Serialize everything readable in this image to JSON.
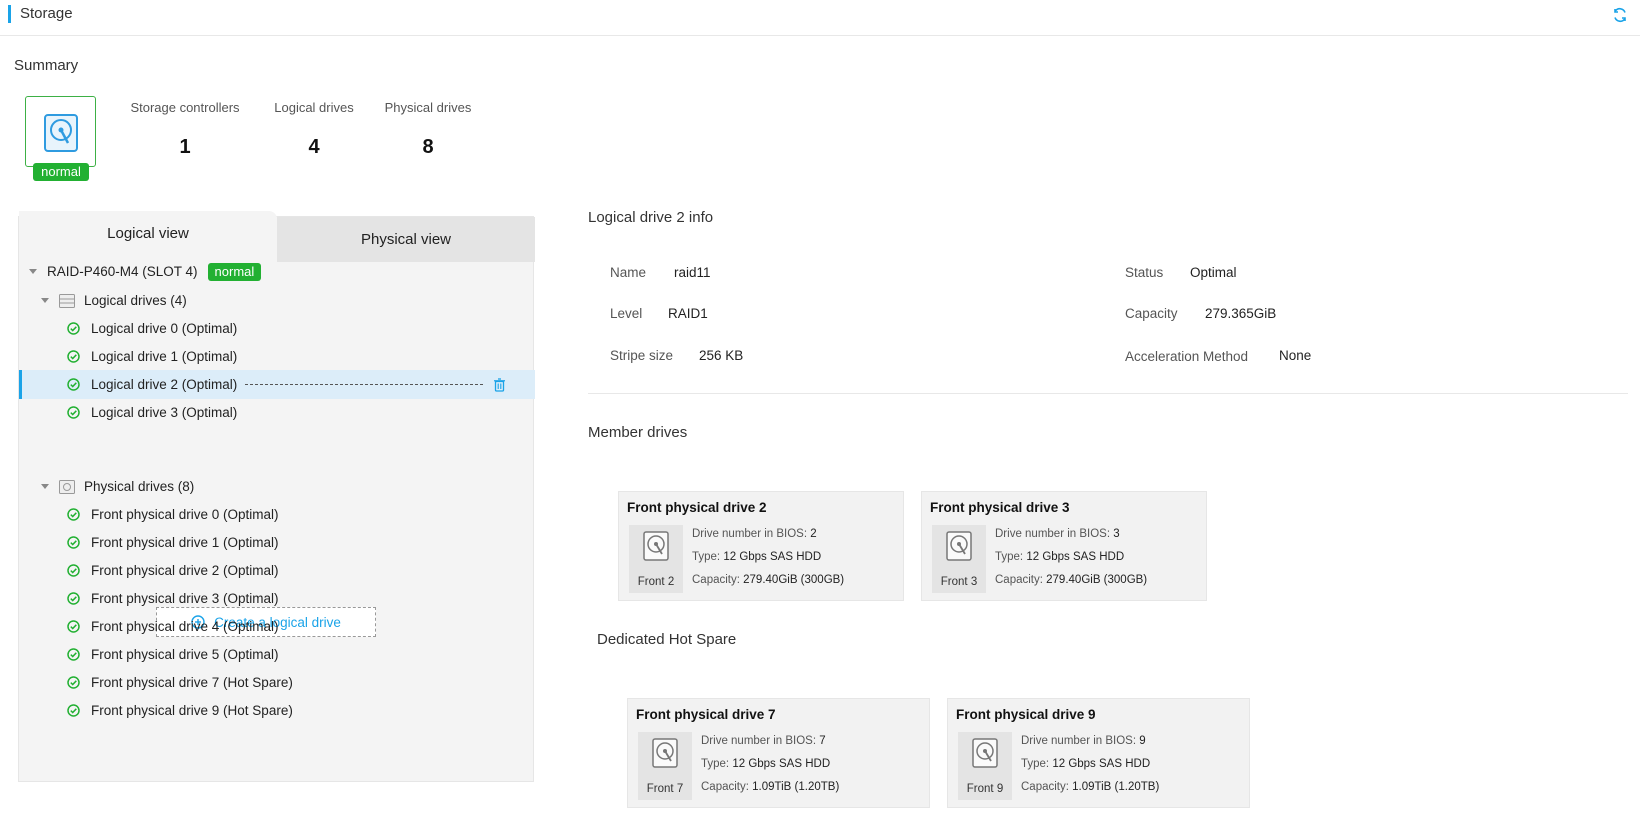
{
  "header": {
    "title": "Storage",
    "refresh_icon": "refresh-icon"
  },
  "summary": {
    "title": "Summary",
    "status_badge": "normal",
    "stats": [
      {
        "label": "Storage controllers",
        "value": "1"
      },
      {
        "label": "Logical drives",
        "value": "4"
      },
      {
        "label": "Physical drives",
        "value": "8"
      }
    ]
  },
  "tabs": {
    "logical": "Logical view",
    "physical": "Physical view"
  },
  "tree": {
    "controller": {
      "label": "RAID-P460-M4 (SLOT 4)",
      "badge": "normal"
    },
    "logical_group": "Logical drives (4)",
    "logical_items": [
      "Logical drive 0 (Optimal)",
      "Logical drive 1 (Optimal)",
      "Logical drive 2 (Optimal)",
      "Logical drive 3 (Optimal)"
    ],
    "selected_index": 2,
    "create_button": "Create a logical drive",
    "physical_group": "Physical drives (8)",
    "physical_items": [
      "Front physical drive 0 (Optimal)",
      "Front physical drive 1 (Optimal)",
      "Front physical drive 2 (Optimal)",
      "Front physical drive 3 (Optimal)",
      "Front physical drive 4 (Optimal)",
      "Front physical drive 5 (Optimal)",
      "Front physical drive 7 (Hot Spare)",
      "Front physical drive 9 (Hot Spare)"
    ]
  },
  "info": {
    "title": "Logical drive 2 info",
    "name_label": "Name",
    "name_value": "raid11",
    "level_label": "Level",
    "level_value": "RAID1",
    "stripe_label": "Stripe size",
    "stripe_value": "256 KB",
    "status_label": "Status",
    "status_value": "Optimal",
    "capacity_label": "Capacity",
    "capacity_value": "279.365GiB",
    "accel_label": "Acceleration Method",
    "accel_value": "None"
  },
  "member_drives": {
    "title": "Member drives",
    "cards": [
      {
        "title": "Front physical drive 2",
        "slot": "Front 2",
        "bios_label": "Drive number in BIOS: ",
        "bios": "2",
        "type_label": "Type: ",
        "type": "12 Gbps SAS HDD",
        "capacity_label": "Capacity: ",
        "capacity": "279.40GiB (300GB)"
      },
      {
        "title": "Front physical drive 3",
        "slot": "Front 3",
        "bios_label": "Drive number in BIOS: ",
        "bios": "3",
        "type_label": "Type: ",
        "type": "12 Gbps SAS HDD",
        "capacity_label": "Capacity: ",
        "capacity": "279.40GiB (300GB)"
      }
    ]
  },
  "hot_spare": {
    "title": "Dedicated Hot Spare",
    "cards": [
      {
        "title": "Front physical drive 7",
        "slot": "Front 7",
        "bios_label": "Drive number in BIOS: ",
        "bios": "7",
        "type_label": "Type: ",
        "type": "12 Gbps SAS HDD",
        "capacity_label": "Capacity: ",
        "capacity": "1.09TiB (1.20TB)"
      },
      {
        "title": "Front physical drive 9",
        "slot": "Front 9",
        "bios_label": "Drive number in BIOS: ",
        "bios": "9",
        "type_label": "Type: ",
        "type": "12 Gbps SAS HDD",
        "capacity_label": "Capacity: ",
        "capacity": "1.09TiB (1.20TB)"
      }
    ]
  },
  "colors": {
    "accent": "#1aa3e8",
    "ok": "#22b032",
    "selected_bg": "#dcedf9"
  }
}
